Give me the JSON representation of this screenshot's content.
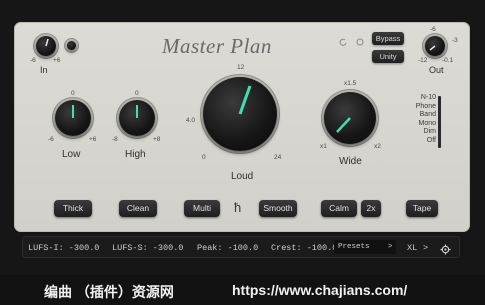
{
  "plugin": {
    "title": "Master Plan",
    "in": {
      "label": "In",
      "min": "-6",
      "max": "+6"
    },
    "out": {
      "label": "Out",
      "top": "-6",
      "left": "-3",
      "min": "-12",
      "max": "-0.1"
    },
    "top_buttons": {
      "bypass": "Bypass",
      "unity": "Unity"
    },
    "low": {
      "label": "Low",
      "top": "0",
      "min": "-6",
      "max": "+6"
    },
    "high": {
      "label": "High",
      "top": "0",
      "min": "-8",
      "max": "+8"
    },
    "loud": {
      "label": "Loud",
      "top": "12",
      "left": "4.0",
      "min": "0",
      "max": "24"
    },
    "wide": {
      "label": "Wide",
      "top": "x1.5",
      "min": "x1",
      "max": "x2"
    },
    "modes": [
      "N-10",
      "Phone",
      "Band",
      "Mono",
      "Dim",
      "Off"
    ],
    "buttons": {
      "thick": "Thick",
      "clean": "Clean",
      "multi": "Multi",
      "smooth": "Smooth",
      "calm": "Calm",
      "x2": "2x",
      "tape": "Tape"
    },
    "logo_glyph": "ħ",
    "meters": {
      "lufs_i": "LUFS-I: -300.0",
      "lufs_s": "LUFS-S: -300.0",
      "peak": "Peak: -100.0",
      "crest": "Crest: -100.0"
    },
    "presets": {
      "label": "Presets",
      "arrow": ">",
      "size": "XL",
      "size_arrow": ">"
    }
  },
  "banner": {
    "left": "编曲 （插件）资源网",
    "right": "https://www.chajians.com/"
  },
  "colors": {
    "accent": "#3ee0b0",
    "panel": "#d8d7d1",
    "knob": "#151515"
  }
}
